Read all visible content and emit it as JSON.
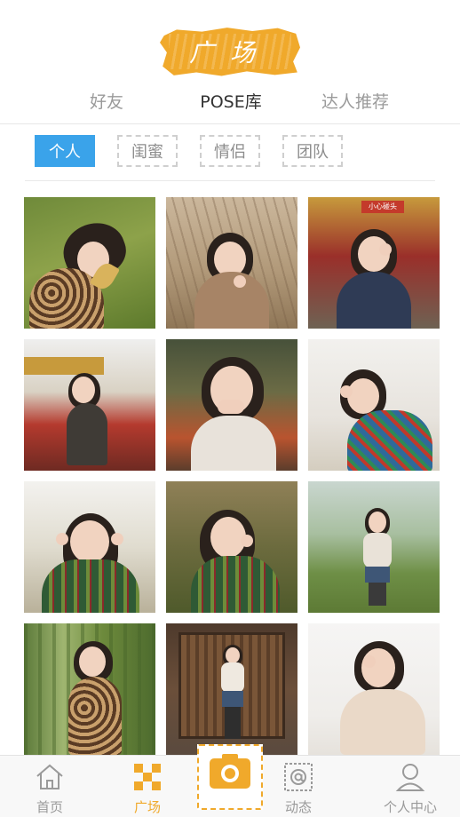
{
  "header": {
    "logo_text": "广场"
  },
  "top_tabs": [
    {
      "label": "好友",
      "active": false
    },
    {
      "label": "POSE库",
      "active": true
    },
    {
      "label": "达人推荐",
      "active": false
    }
  ],
  "filter_chips": [
    {
      "label": "个人",
      "active": true
    },
    {
      "label": "闺蜜",
      "active": false
    },
    {
      "label": "情侣",
      "active": false
    },
    {
      "label": "团队",
      "active": false
    }
  ],
  "photos": [
    {
      "subject": "woman lying on grass holding leaf",
      "scene": "grass"
    },
    {
      "subject": "woman crouching in dry reeds making peace sign",
      "scene": "reeds"
    },
    {
      "subject": "woman with hand over eye near red train",
      "scene": "train",
      "sign_text": "小心碰头"
    },
    {
      "subject": "woman standing on red train carriage",
      "scene": "train"
    },
    {
      "subject": "woman covering mouth with hands",
      "scene": "train"
    },
    {
      "subject": "woman with scarf making circle with fingers",
      "scene": "bright"
    },
    {
      "subject": "woman in plaid shirt making peace signs",
      "scene": "bamboo"
    },
    {
      "subject": "woman in plaid shirt pointing at face",
      "scene": "park"
    },
    {
      "subject": "woman standing in park pointing up",
      "scene": "park"
    },
    {
      "subject": "woman in bamboo forest with scarf",
      "scene": "bamboo"
    },
    {
      "subject": "woman standing at wooden door",
      "scene": "door"
    },
    {
      "subject": "woman with hand over eye in sweater",
      "scene": "bright"
    }
  ],
  "bottom_nav": [
    {
      "label": "首页",
      "icon": "home-icon",
      "active": false
    },
    {
      "label": "广场",
      "icon": "square-grid-icon",
      "active": true
    },
    {
      "label": "",
      "icon": "camera-icon",
      "active": false
    },
    {
      "label": "动态",
      "icon": "at-sign-icon",
      "active": false
    },
    {
      "label": "个人中心",
      "icon": "user-icon",
      "active": false
    }
  ],
  "colors": {
    "accent": "#f0a92b",
    "chip_active": "#3aa3ea",
    "text_muted": "#9a9a9a"
  }
}
